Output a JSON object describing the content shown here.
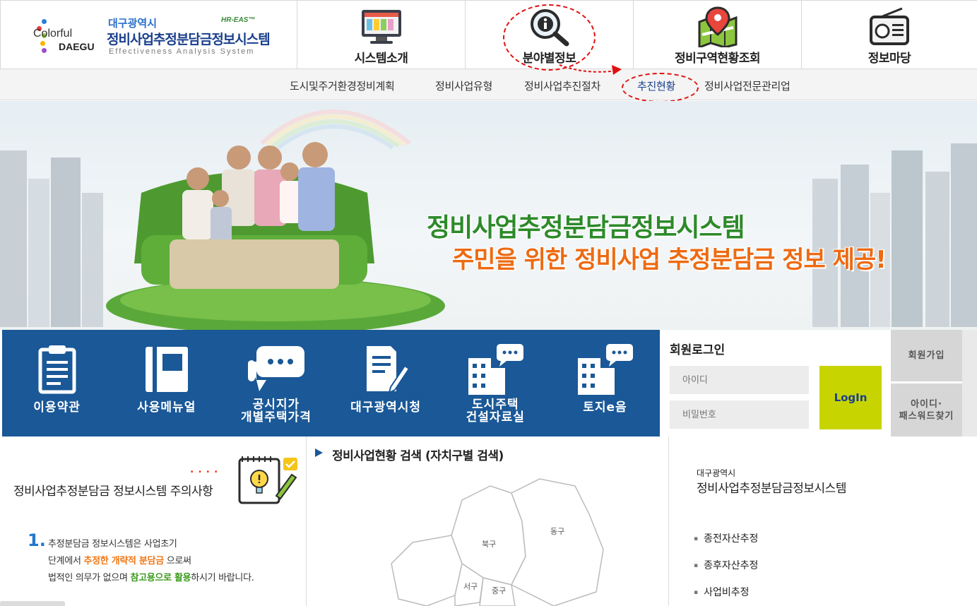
{
  "header": {
    "logo": {
      "colorful": "Colorful",
      "daegu": "DAEGU",
      "city": "대구광역시",
      "system": "정비사업추정분담금정보시스템",
      "english": "Effectiveness Analysis System",
      "badge": "HR-EAS™"
    },
    "nav": [
      {
        "label": "시스템소개",
        "icon": "monitor-icon"
      },
      {
        "label": "분야별정보",
        "icon": "info-search-icon"
      },
      {
        "label": "정비구역현황조회",
        "icon": "map-pin-icon"
      },
      {
        "label": "정보마당",
        "icon": "radio-icon"
      }
    ]
  },
  "subnav": {
    "items": [
      "도시및주거환경정비계획",
      "정비사업유형",
      "정비사업추진절차",
      "추진현황",
      "정비사업전문관리업"
    ],
    "active_index": 3
  },
  "banner": {
    "title": "정비사업추정분담금정보시스템",
    "subtitle": "주민을 위한 정비사업 추정분담금 정보 제공!"
  },
  "quick_menu": [
    {
      "label": "이용약관",
      "icon": "clipboard-icon"
    },
    {
      "label": "사용메뉴얼",
      "icon": "book-icon"
    },
    {
      "label_line1": "공시지가",
      "label_line2": "개별주택가격",
      "icon": "chat-bubble-icon"
    },
    {
      "label": "대구광역시청",
      "icon": "document-pen-icon"
    },
    {
      "label_line1": "도시주택",
      "label_line2": "건설자료실",
      "icon": "building-chat-icon"
    },
    {
      "label": "토지e음",
      "icon": "building-chat-icon"
    }
  ],
  "login": {
    "title": "회원로그인",
    "id_placeholder": "아이디",
    "pw_placeholder": "비밀번호",
    "button": "LogIn",
    "join": "회원가입",
    "find_line1": "아이디·",
    "find_line2": "패스워드찾기"
  },
  "notice": {
    "title": "정비사업추정분담금 정보시스템 주의사항",
    "dots": "....",
    "number": "1.",
    "line1": "추정분담금 정보시스템은 사업초기",
    "line2_a": "단계에서 ",
    "line2_b": "추정한 개략적 분담금",
    "line2_c": " 으로써",
    "line3_a": "법적인 의무가 없으며 ",
    "line3_b": "참고용으로 활용",
    "line3_c": "하시기 바랍니다."
  },
  "search": {
    "title": "정비사업현황 검색 (자치구별 검색)",
    "districts": [
      "북구",
      "동구",
      "서구",
      "중구"
    ]
  },
  "info": {
    "small": "대구광역시",
    "big": "정비사업추정분담금정보시스템",
    "items": [
      "종전자산추정",
      "종후자산추정",
      "사업비추정"
    ]
  },
  "colors": {
    "primary_blue": "#1a5897",
    "login_green": "#c8d400",
    "banner_green": "#2d8a2a",
    "banner_orange": "#ee6a12",
    "annotation_red": "#e01010"
  }
}
